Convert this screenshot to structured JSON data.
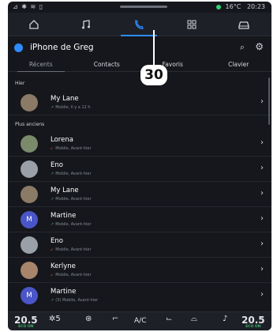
{
  "status": {
    "left_icons": "⊿ ✱ ≋ ▯",
    "temp": "16°C",
    "time": "20:23"
  },
  "nav": {
    "home_icon": "home-icon",
    "music_icon": "music-icon",
    "phone_icon": "phone-icon",
    "apps_icon": "apps-icon",
    "car_icon": "car-icon"
  },
  "header": {
    "title": "iPhone de Greg",
    "search_icon": "search-icon",
    "settings_icon": "gear-icon"
  },
  "tabs": [
    {
      "label": "Récents"
    },
    {
      "label": "Contacts"
    },
    {
      "label": "Favoris"
    },
    {
      "label": "Clavier"
    }
  ],
  "callout": "30",
  "sections": {
    "yesterday": "Hier",
    "older": "Plus anciens"
  },
  "calls": [
    {
      "name": "My Lane",
      "detail": "Mobile, Il y a 12 h",
      "avatar": "",
      "avatar_color": "#8b7a66",
      "dir": "out"
    },
    {
      "name": "Lorena",
      "detail": "Mobile, Avant-hier",
      "avatar": "",
      "avatar_color": "#7a8a6a",
      "dir": "in"
    },
    {
      "name": "Eno",
      "detail": "Mobile, Avant-hier",
      "avatar": "",
      "avatar_color": "#9aa0a8",
      "dir": "out"
    },
    {
      "name": "My Lane",
      "detail": "Mobile, Avant-hier",
      "avatar": "",
      "avatar_color": "#8b7a66",
      "dir": "out"
    },
    {
      "name": "Martine",
      "detail": "Mobile, Avant-hier",
      "avatar": "M",
      "avatar_color": "#4a56c8",
      "dir": "out"
    },
    {
      "name": "Eno",
      "detail": "Mobile, Avant-hier",
      "avatar": "",
      "avatar_color": "#9aa0a8",
      "dir": "in"
    },
    {
      "name": "Kerlyne",
      "detail": "Mobile, Avant-hier",
      "avatar": "",
      "avatar_color": "#a8846a",
      "dir": "in"
    },
    {
      "name": "Martine",
      "detail": "(3) Mobile, Avant-hier",
      "avatar": "M",
      "avatar_color": "#4a56c8",
      "dir": "out"
    }
  ],
  "bottom": {
    "temp_left": "20.5",
    "temp_left_label": "ECO ON",
    "fan": "5",
    "ac": "A/C",
    "temp_right": "20.5",
    "temp_right_label": "ECO ON"
  }
}
